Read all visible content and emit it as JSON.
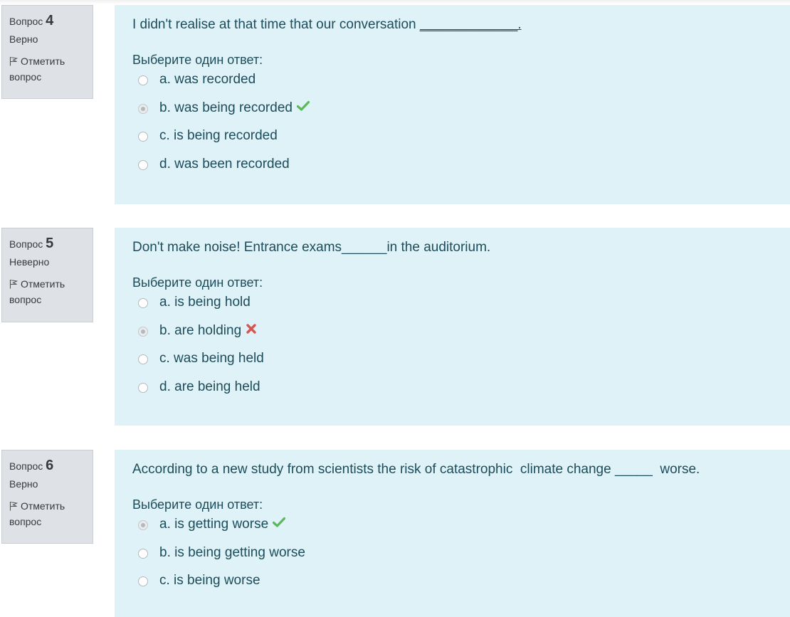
{
  "questions": [
    {
      "label": "Вопрос",
      "number": "4",
      "state": "Верно",
      "flag": "Отметить вопрос",
      "text_before": "I didn't realise at that time that our conversation ",
      "blank": "_____________.",
      "text_after": "",
      "prompt": "Выберите один ответ:",
      "answers": [
        {
          "label": "a. was recorded",
          "checked": false,
          "mark": ""
        },
        {
          "label": "b. was being recorded",
          "checked": true,
          "mark": "check-icon"
        },
        {
          "label": "c. is being recorded",
          "checked": false,
          "mark": ""
        },
        {
          "label": "d. was been recorded",
          "checked": false,
          "mark": ""
        }
      ]
    },
    {
      "label": "Вопрос",
      "number": "5",
      "state": "Неверно",
      "flag": "Отметить вопрос",
      "text_before": "Don't make noise! Entrance exams______in the auditorium.",
      "blank": "",
      "text_after": "",
      "prompt": "Выберите один ответ:",
      "answers": [
        {
          "label": "a. is being hold",
          "checked": false,
          "mark": ""
        },
        {
          "label": "b. are holding",
          "checked": true,
          "mark": "cross-icon"
        },
        {
          "label": "c. was being held",
          "checked": false,
          "mark": ""
        },
        {
          "label": "d. are being held",
          "checked": false,
          "mark": ""
        }
      ]
    },
    {
      "label": "Вопрос",
      "number": "6",
      "state": "Верно",
      "flag": "Отметить вопрос",
      "text_before": "According to a new study from scientists the risk of catastrophic  climate change _____  worse.",
      "blank": "",
      "text_after": "",
      "prompt": "Выберите один ответ:",
      "answers": [
        {
          "label": "a. is getting worse",
          "checked": true,
          "mark": "check-icon"
        },
        {
          "label": "b. is being getting worse",
          "checked": false,
          "mark": ""
        },
        {
          "label": "c. is being worse",
          "checked": false,
          "mark": ""
        }
      ]
    }
  ],
  "colors": {
    "correct": "#5cb85c",
    "incorrect": "#d9534f",
    "content_bg": "#def2f8",
    "info_bg": "#dee2e6"
  }
}
